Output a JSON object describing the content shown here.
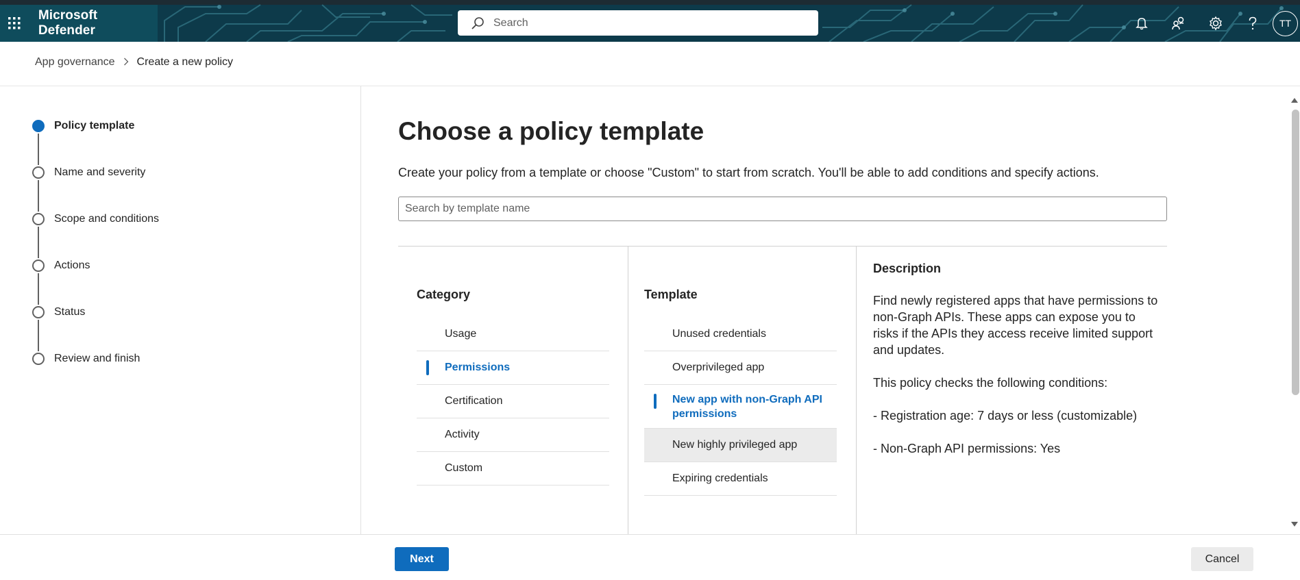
{
  "header": {
    "app_title": "Microsoft Defender",
    "search_placeholder": "Search",
    "user_initials": "TT",
    "icons": [
      "waffle-icon",
      "search-icon",
      "bell-icon",
      "community-icon",
      "gear-icon",
      "help-icon"
    ]
  },
  "breadcrumb": {
    "parent": "App governance",
    "current": "Create a new policy"
  },
  "steps": [
    {
      "label": "Policy template",
      "active": true
    },
    {
      "label": "Name and severity",
      "active": false
    },
    {
      "label": "Scope and conditions",
      "active": false
    },
    {
      "label": "Actions",
      "active": false
    },
    {
      "label": "Status",
      "active": false
    },
    {
      "label": "Review and finish",
      "active": false
    }
  ],
  "main": {
    "title": "Choose a policy template",
    "subtitle": "Create your policy from a template or choose \"Custom\" to start from scratch. You'll be able to add conditions and specify actions.",
    "template_search_placeholder": "Search by template name"
  },
  "category": {
    "heading": "Category",
    "items": [
      "Usage",
      "Permissions",
      "Certification",
      "Activity",
      "Custom"
    ],
    "selected": "Permissions"
  },
  "template": {
    "heading": "Template",
    "items": [
      "Unused credentials",
      "Overprivileged app",
      "New app with non-Graph API permissions",
      "New highly privileged app",
      "Expiring credentials"
    ],
    "selected": "New app with non-Graph API permissions",
    "hovered": "New highly privileged app"
  },
  "description": {
    "heading": "Description",
    "paragraphs": [
      "Find newly registered apps that have permissions to non-Graph APIs. These apps can expose you to risks if the APIs they access receive limited support and updates.",
      "This policy checks the following conditions:",
      "- Registration age: 7 days or less (customizable)",
      "- Non-Graph API permissions: Yes"
    ]
  },
  "footer": {
    "next_label": "Next",
    "cancel_label": "Cancel"
  },
  "colors": {
    "accent": "#0f6cbd",
    "header_bg": "#0d3a4a"
  }
}
